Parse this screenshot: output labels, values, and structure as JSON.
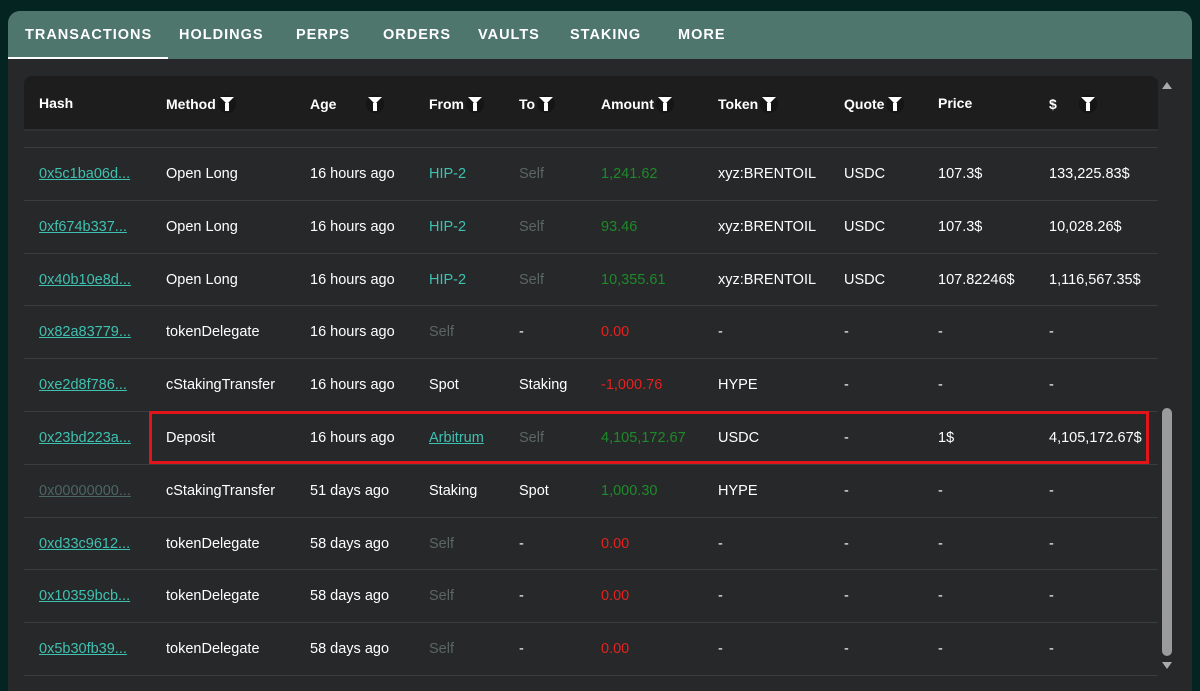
{
  "tabs": [
    "TRANSACTIONS",
    "HOLDINGS",
    "PERPS",
    "ORDERS",
    "VAULTS",
    "STAKING",
    "MORE"
  ],
  "columns": [
    "Hash",
    "Method",
    "Age",
    "From",
    "To",
    "Amount",
    "Token",
    "Quote",
    "Price",
    "$"
  ],
  "rows": [
    {
      "hash": "0x5c1ba06d...",
      "method": "Open Long",
      "age": "16 hours ago",
      "from": "HIP-2",
      "to": "Self",
      "amount": "1,241.62",
      "token": "xyz:BRENTOIL",
      "quote": "USDC",
      "price": "107.3$",
      "usd": "133,225.83$"
    },
    {
      "hash": "0xf674b337...",
      "method": "Open Long",
      "age": "16 hours ago",
      "from": "HIP-2",
      "to": "Self",
      "amount": "93.46",
      "token": "xyz:BRENTOIL",
      "quote": "USDC",
      "price": "107.3$",
      "usd": "10,028.26$"
    },
    {
      "hash": "0x40b10e8d...",
      "method": "Open Long",
      "age": "16 hours ago",
      "from": "HIP-2",
      "to": "Self",
      "amount": "10,355.61",
      "token": "xyz:BRENTOIL",
      "quote": "USDC",
      "price": "107.82246$",
      "usd": "1,116,567.35$"
    },
    {
      "hash": "0x82a83779...",
      "method": "tokenDelegate",
      "age": "16 hours ago",
      "from": "Self",
      "to": "-",
      "amount": "0.00",
      "token": "-",
      "quote": "-",
      "price": "-",
      "usd": "-"
    },
    {
      "hash": "0xe2d8f786...",
      "method": "cStakingTransfer",
      "age": "16 hours ago",
      "from": "Spot",
      "to": "Staking",
      "amount": "-1,000.76",
      "token": "HYPE",
      "quote": "-",
      "price": "-",
      "usd": "-"
    },
    {
      "hash": "0x23bd223a...",
      "method": "Deposit",
      "age": "16 hours ago",
      "from": "Arbitrum",
      "to": "Self",
      "amount": "4,105,172.67",
      "token": "USDC",
      "quote": "-",
      "price": "1$",
      "usd": "4,105,172.67$"
    },
    {
      "hash": "0x00000000...",
      "method": "cStakingTransfer",
      "age": "51 days ago",
      "from": "Staking",
      "to": "Spot",
      "amount": "1,000.30",
      "token": "HYPE",
      "quote": "-",
      "price": "-",
      "usd": "-"
    },
    {
      "hash": "0xd33c9612...",
      "method": "tokenDelegate",
      "age": "58 days ago",
      "from": "Self",
      "to": "-",
      "amount": "0.00",
      "token": "-",
      "quote": "-",
      "price": "-",
      "usd": "-"
    },
    {
      "hash": "0x10359bcb...",
      "method": "tokenDelegate",
      "age": "58 days ago",
      "from": "Self",
      "to": "-",
      "amount": "0.00",
      "token": "-",
      "quote": "-",
      "price": "-",
      "usd": "-"
    },
    {
      "hash": "0x5b30fb39...",
      "method": "tokenDelegate",
      "age": "58 days ago",
      "from": "Self",
      "to": "-",
      "amount": "0.00",
      "token": "-",
      "quote": "-",
      "price": "-",
      "usd": "-"
    }
  ]
}
